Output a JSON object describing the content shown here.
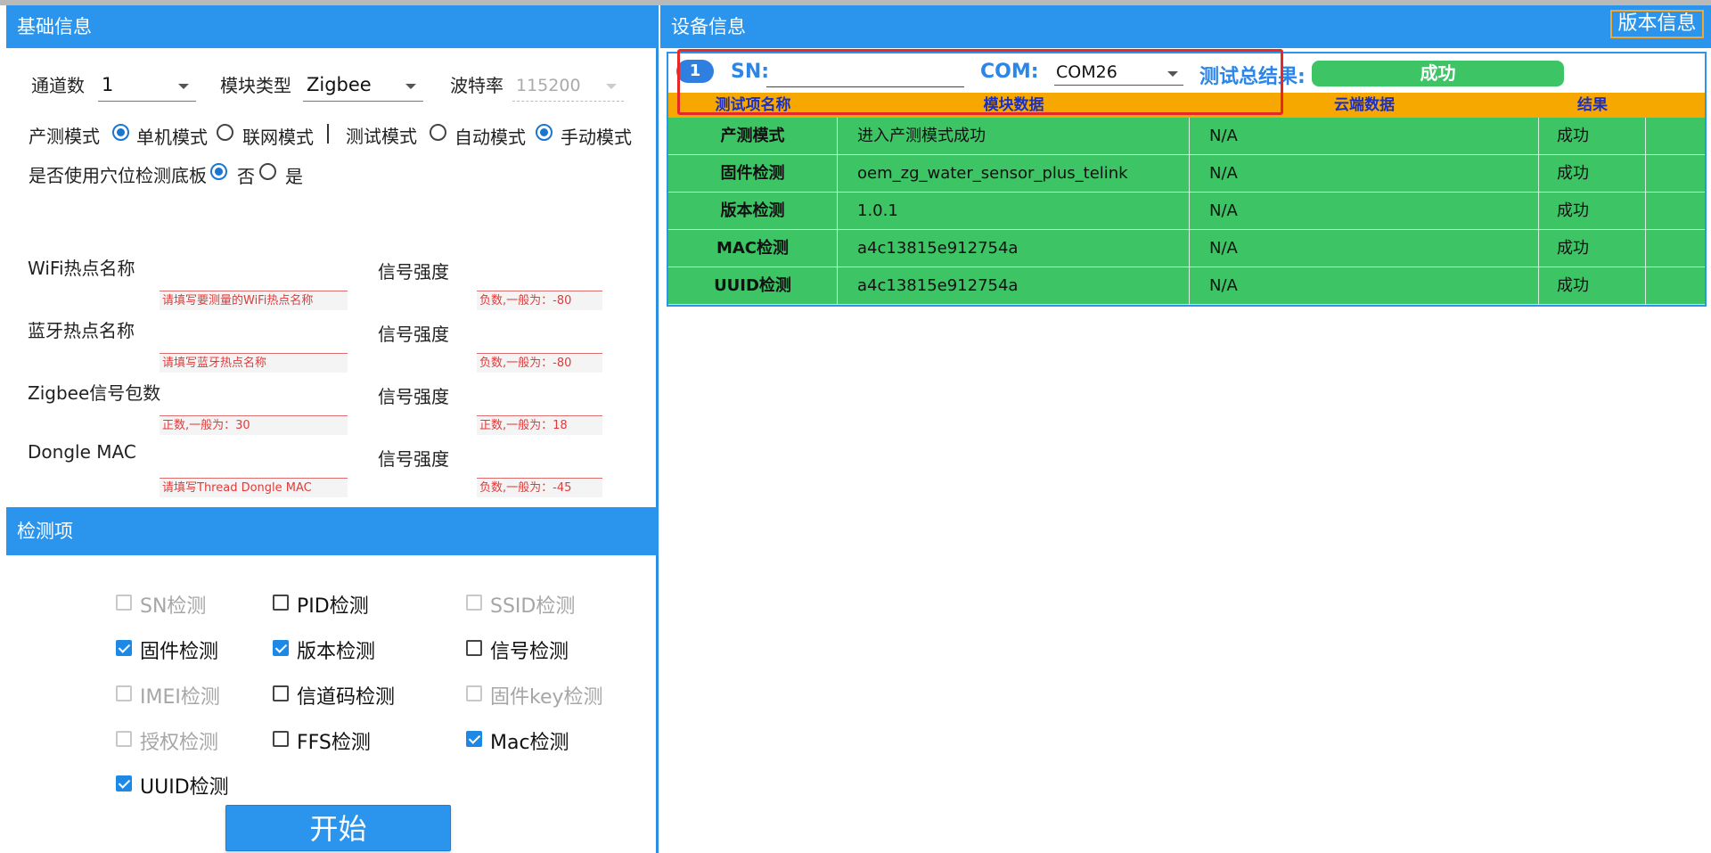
{
  "left": {
    "header_basic": "基础信息",
    "channels_label": "通道数",
    "channels_value": "1",
    "module_type_label": "模块类型",
    "module_type_value": "Zigbee",
    "baud_label": "波特率",
    "baud_value": "115200",
    "prod_mode_label": "产测模式",
    "prod_mode_opt1": "单机模式",
    "prod_mode_opt2": "联网模式",
    "test_mode_label": "测试模式",
    "test_mode_opt1": "自动模式",
    "test_mode_opt2": "手动模式",
    "cave_label": "是否使用穴位检测底板",
    "cave_no": "否",
    "cave_yes": "是",
    "wifi_label": "WiFi热点名称",
    "wifi_hint": "请填写要测量的WiFi热点名称",
    "signal_label": "信号强度",
    "wifi_signal_hint": "负数,一般为：-80",
    "bt_label": "蓝牙热点名称",
    "bt_hint": "请填写蓝牙热点名称",
    "bt_signal_hint": "负数,一般为：-80",
    "zigbee_label": "Zigbee信号包数",
    "zigbee_hint": "正数,一般为：30",
    "zigbee_signal_hint": "正数,一般为：18",
    "dongle_label": "Dongle MAC",
    "dongle_hint": "请填写Thread Dongle MAC",
    "dongle_signal_hint": "负数,一般为：-45",
    "header_checks": "检测项",
    "checks": {
      "sn": "SN检测",
      "pid": "PID检测",
      "ssid": "SSID检测",
      "firmware": "固件检测",
      "version": "版本检测",
      "signal": "信号检测",
      "imei": "IMEI检测",
      "channel_code": "信道码检测",
      "firmware_key": "固件key检测",
      "auth": "授权检测",
      "ffs": "FFS检测",
      "mac": "Mac检测",
      "uuid": "UUID检测"
    },
    "start_button": "开始"
  },
  "right": {
    "header": "设备信息",
    "version_button": "版本信息",
    "device_index": "1",
    "sn_label": "SN:",
    "com_label": "COM:",
    "com_value": "COM26",
    "total_result_label": "测试总结果:",
    "total_result_value": "成功",
    "table": {
      "headers": [
        "测试项名称",
        "模块数据",
        "云端数据",
        "结果"
      ],
      "rows": [
        {
          "name": "产测模式",
          "module": "进入产测模式成功",
          "cloud": "N/A",
          "result": "成功"
        },
        {
          "name": "固件检测",
          "module": "oem_zg_water_sensor_plus_telink",
          "cloud": "N/A",
          "result": "成功"
        },
        {
          "name": "版本检测",
          "module": "1.0.1",
          "cloud": "N/A",
          "result": "成功"
        },
        {
          "name": "MAC检测",
          "module": "a4c13815e912754a",
          "cloud": "N/A",
          "result": "成功"
        },
        {
          "name": "UUID检测",
          "module": "a4c13815e912754a",
          "cloud": "N/A",
          "result": "成功"
        }
      ]
    }
  },
  "colors": {
    "header_blue": "#2b95ee",
    "success_green": "#3cc465",
    "table_header_orange": "#f6a800",
    "highlight_red": "#e62828"
  }
}
